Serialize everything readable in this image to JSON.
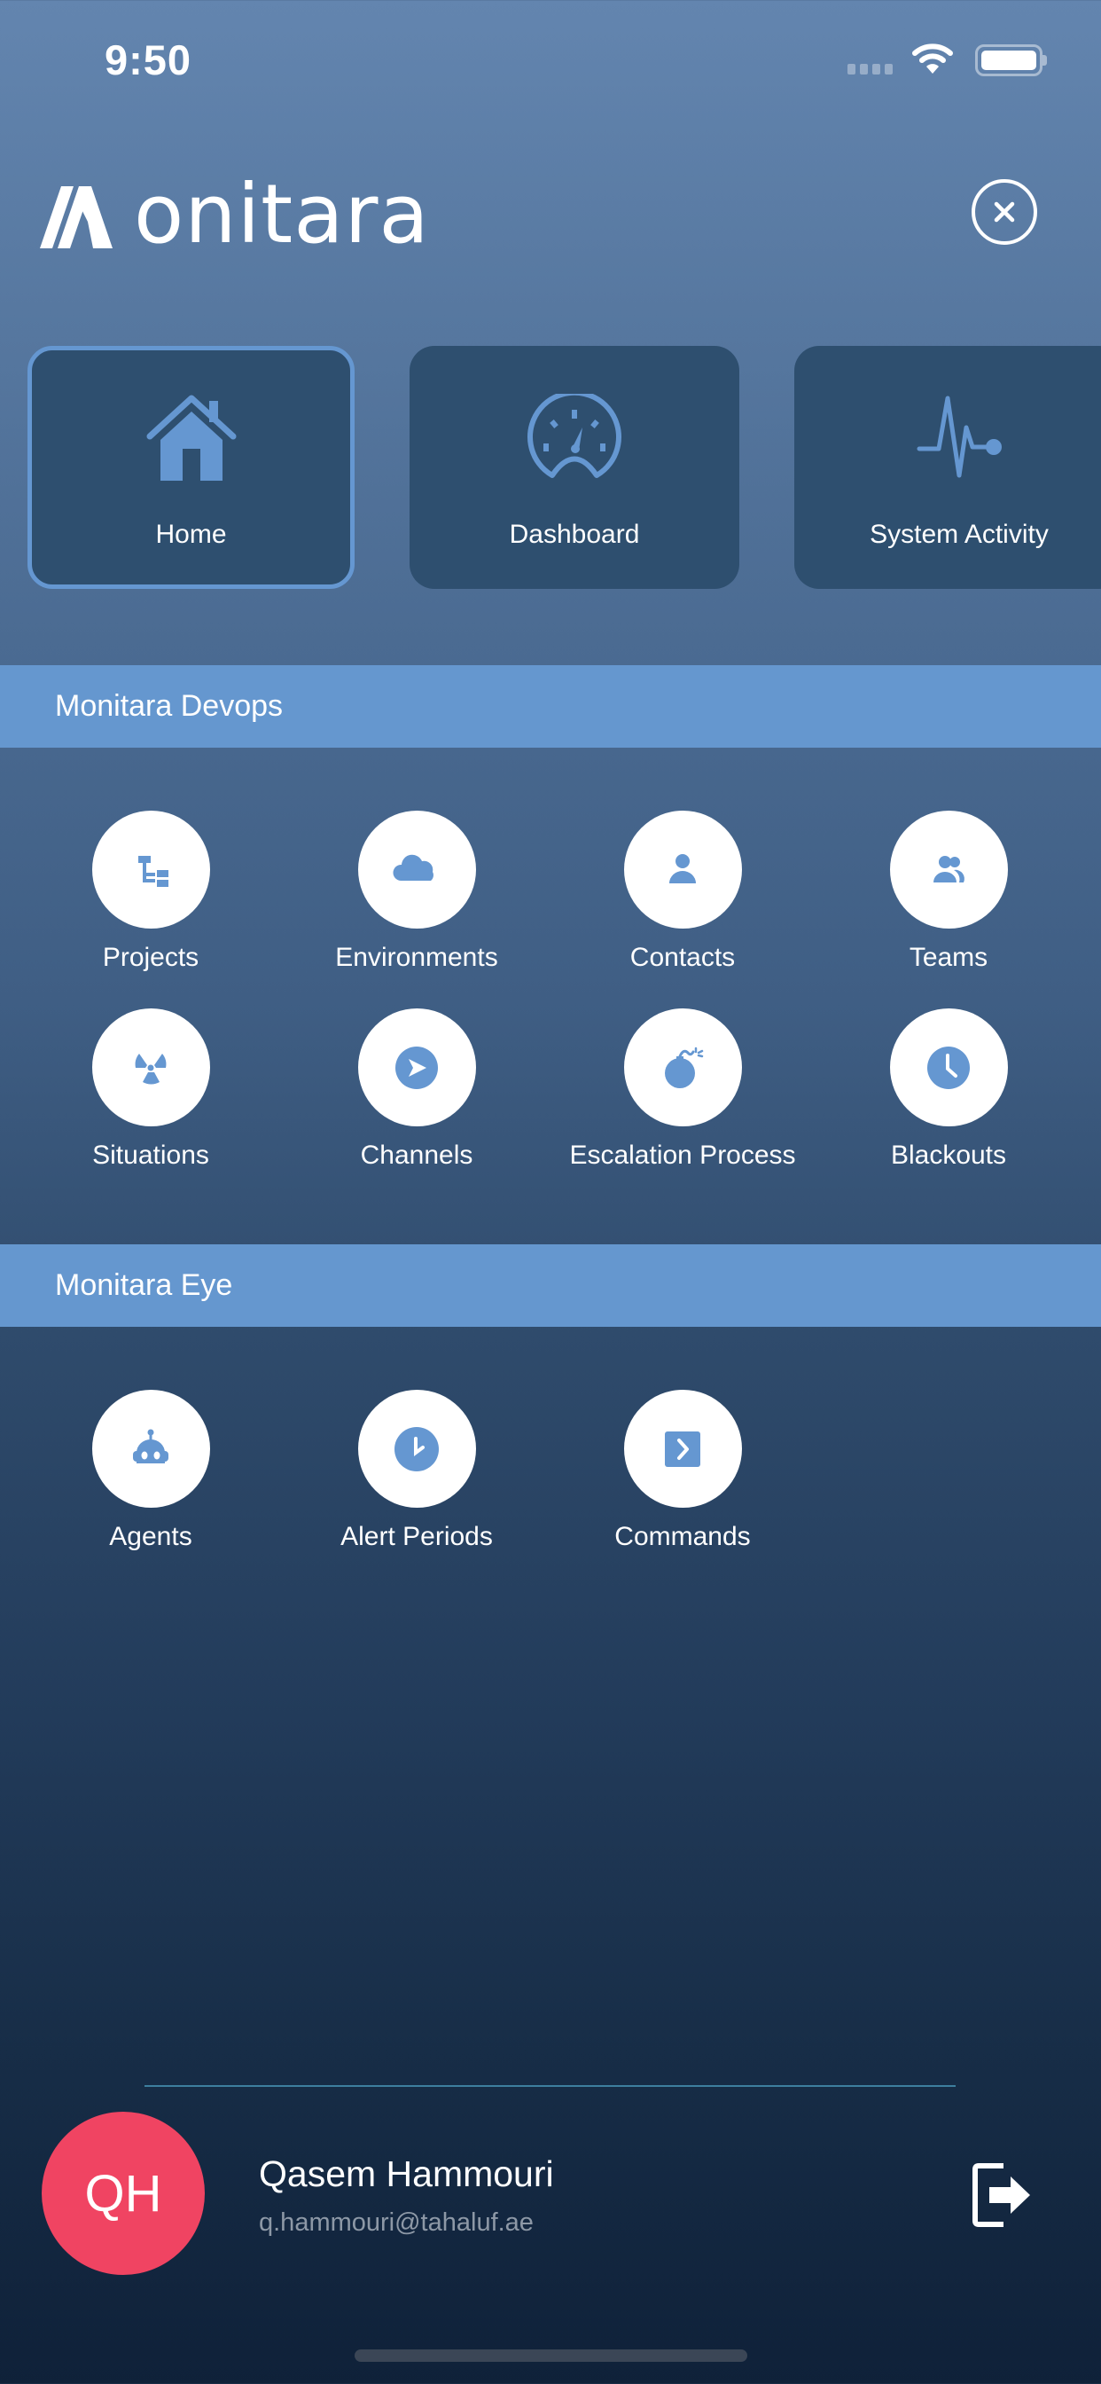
{
  "status_bar": {
    "time": "9:50",
    "wifi_icon": "wifi-icon",
    "battery_icon": "battery-icon",
    "signal_icon": "cellular-signal-icon"
  },
  "header": {
    "logo_text": "onitara",
    "logo_alt": "Monitara",
    "close_icon": "close-circle-icon"
  },
  "quick_tiles": [
    {
      "label": "Home",
      "icon": "home-icon",
      "active": true
    },
    {
      "label": "Dashboard",
      "icon": "speedometer-icon",
      "active": false
    },
    {
      "label": "System Activity",
      "icon": "heartbeat-icon",
      "active": false
    }
  ],
  "sections": [
    {
      "title": "Monitara Devops",
      "items": [
        {
          "label": "Projects",
          "icon": "sitemap-icon"
        },
        {
          "label": "Environments",
          "icon": "cloud-icon"
        },
        {
          "label": "Contacts",
          "icon": "user-icon"
        },
        {
          "label": "Teams",
          "icon": "users-icon"
        },
        {
          "label": "Situations",
          "icon": "radiation-icon"
        },
        {
          "label": "Channels",
          "icon": "send-circle-icon"
        },
        {
          "label": "Escalation Process",
          "icon": "bomb-icon"
        },
        {
          "label": "Blackouts",
          "icon": "clock-icon"
        }
      ]
    },
    {
      "title": "Monitara Eye",
      "items": [
        {
          "label": "Agents",
          "icon": "robot-icon"
        },
        {
          "label": "Alert Periods",
          "icon": "clock-icon"
        },
        {
          "label": "Commands",
          "icon": "terminal-chevron-icon"
        }
      ]
    }
  ],
  "user": {
    "initials": "QH",
    "name": "Qasem Hammouri",
    "email": "q.hammouri@tahaluf.ae",
    "avatar_color": "#f04462",
    "logout_icon": "logout-icon"
  },
  "colors": {
    "accent": "#6597cf",
    "tile_bg": "#2e4f6f",
    "icon_blue": "#6597d1"
  }
}
